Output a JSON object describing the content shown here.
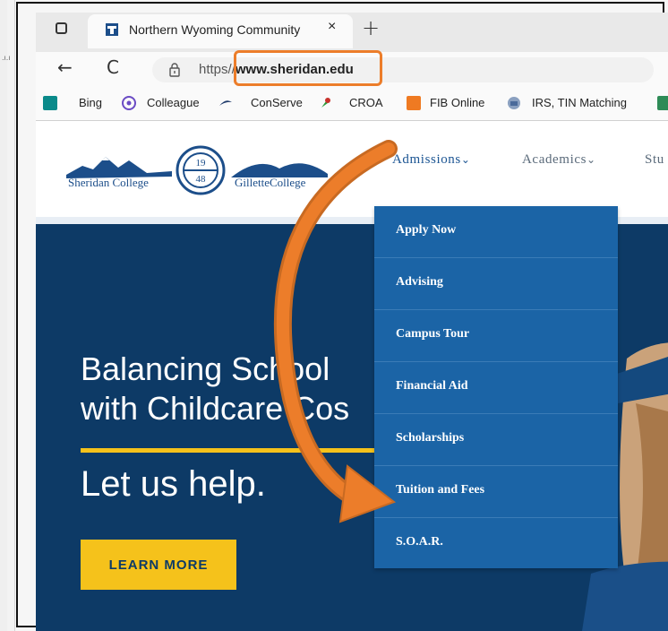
{
  "browser": {
    "tab_title": "Northern Wyoming Community",
    "tab_close": "×",
    "new_tab": "+",
    "back": "←",
    "reload": "C",
    "url_scheme": "https",
    "url_separator": "//",
    "url_host": "www.sheridan.edu",
    "favorites": [
      {
        "label": "Bing",
        "icon": "bing-icon",
        "color": "#0a8a8a"
      },
      {
        "label": "Colleague",
        "icon": "colleague-icon",
        "color": "#6a4bc4"
      },
      {
        "label": "ConServe",
        "icon": "conserve-icon",
        "color": "#1f3a6a"
      },
      {
        "label": "CROA",
        "icon": "croa-icon",
        "color": "#c8322b"
      },
      {
        "label": "FIB Online",
        "icon": "fib-icon",
        "color": "#ef7a22"
      },
      {
        "label": "IRS, TIN Matching",
        "icon": "irs-icon",
        "color": "#4a6a9a"
      },
      {
        "label": "",
        "icon": "extra-favorite-icon",
        "color": "#2e8b57"
      }
    ]
  },
  "site": {
    "logos": {
      "sheridan": "Sheridan College",
      "seal_top": "19",
      "seal_bottom": "48",
      "gillette": "GilletteCollege"
    },
    "nav": [
      {
        "label": "Admissions",
        "chevron": "⌄"
      },
      {
        "label": "Academics",
        "chevron": "⌄"
      },
      {
        "label": "Stu"
      }
    ],
    "hero": {
      "title_line1": "Balancing School",
      "title_line2": "with Childcare Cos",
      "subtitle": "Let us help.",
      "cta": "LEARN MORE"
    },
    "admissions_menu": [
      "Apply Now",
      "Advising",
      "Campus Tour",
      "Financial Aid",
      "Scholarships",
      "Tuition and Fees",
      "S.O.A.R."
    ]
  },
  "colors": {
    "annotation": "#ec7d2a",
    "menu_bg": "#1b64a6",
    "hero_bg": "#0d3a66",
    "accent_yellow": "#f5c21b"
  }
}
